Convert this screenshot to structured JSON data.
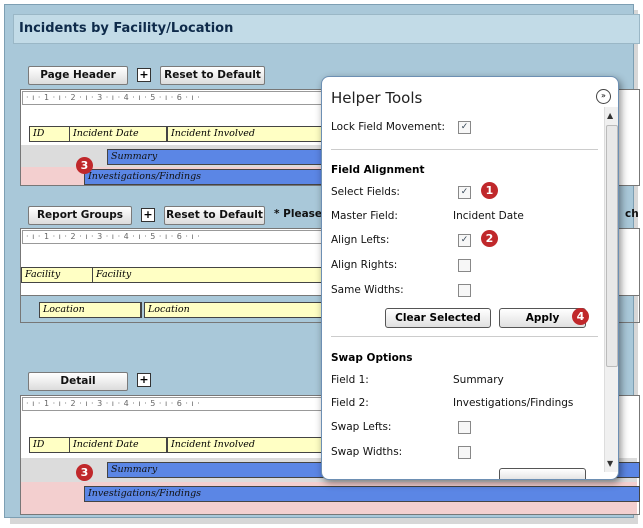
{
  "report_title": "Incidents by Facility/Location",
  "ruler_text": "· ı · 1 · ı · 2 · ı · 3 · ı · 4 · ı · 5 · ı · 6 · ı ·",
  "page_header": {
    "button": "Page Header",
    "reset": "Reset to Default",
    "expand": "+",
    "fields": {
      "id": "ID",
      "incident_date": "Incident Date",
      "incident_involved": "Incident Involved",
      "summary": "Summary",
      "investigations": "Investigations/Findings"
    },
    "badge": "3"
  },
  "report_groups": {
    "button": "Report Groups",
    "reset": "Reset to Default",
    "expand": "+",
    "hint": "* Please",
    "hint_tail": "ch",
    "fields": {
      "facility_label": "Facility",
      "facility_value": "Facility",
      "location_label": "Location",
      "location_value": "Location"
    }
  },
  "detail": {
    "button": "Detail",
    "expand": "+",
    "fields": {
      "id": "ID",
      "incident_date": "Incident Date",
      "incident_involved": "Incident Involved",
      "summary": "Summary",
      "investigations": "Investigations/Findings"
    },
    "badge": "3"
  },
  "helper": {
    "title": "Helper Tools",
    "collapse_glyph": "»",
    "lock_label": "Lock Field Movement:",
    "lock_checked": true,
    "field_alignment": {
      "heading": "Field Alignment",
      "select_fields": "Select Fields:",
      "master_field_label": "Master Field:",
      "master_field_value": "Incident Date",
      "align_lefts": "Align Lefts:",
      "align_rights": "Align Rights:",
      "same_widths": "Same Widths:",
      "clear_selected": "Clear Selected",
      "apply": "Apply",
      "badge1": "1",
      "badge2": "2",
      "badge4": "4"
    },
    "swap": {
      "heading": "Swap Options",
      "field1_label": "Field 1:",
      "field1_value": "Summary",
      "field2_label": "Field 2:",
      "field2_value": "Investigations/Findings",
      "swap_lefts": "Swap Lefts:",
      "swap_widths": "Swap Widths:"
    },
    "check_glyph": "✓"
  }
}
